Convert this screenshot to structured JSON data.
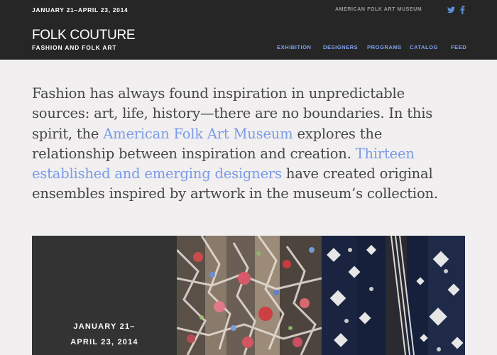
{
  "header": {
    "dates": "JANUARY 21–APRIL 23, 2014",
    "museum": "AMERICAN FOLK ART MUSEUM",
    "title": "FOLK COUTURE",
    "subtitle": "FASHION AND FOLK ART",
    "social": [
      {
        "icon": "twitter-icon",
        "color": "#5a8fd0"
      },
      {
        "icon": "facebook-icon",
        "color": "#5a8fd0"
      }
    ],
    "nav": [
      {
        "label": "Exhibition"
      },
      {
        "label": "Designers"
      },
      {
        "label": "Programs"
      },
      {
        "label": "Catalog"
      },
      {
        "label": "Feed"
      }
    ]
  },
  "intro": {
    "part1": "Fashion has always found inspiration in unpredictable sources: art, life, history—there are no boundaries. In this spirit, the ",
    "link1": "American Folk Art Museum",
    "part2": " explores the relationship between inspiration and creation. ",
    "link2": "Thirteen established and emerging designers",
    "part3": " have created original ensembles inspired by artwork in the museum’s collection."
  },
  "feature": {
    "date_line1": "JANUARY 21–",
    "date_line2": "APRIL 23, 2014"
  },
  "colors": {
    "header_bg": "#262626",
    "accent_link": "#7a9bea",
    "page_bg": "#f1efef",
    "panel_bg": "#333333"
  }
}
